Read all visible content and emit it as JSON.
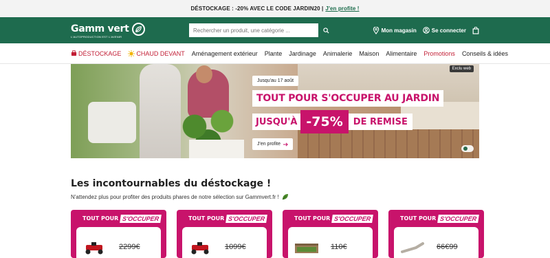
{
  "promo_bar": {
    "text": "DÉSTOCKAGE : -20% AVEC LE CODE JARDIN20 |",
    "link": "J'en profite !"
  },
  "header": {
    "logo_text": "Gamm vert",
    "logo_tagline": "L'AUTOPRODUCTION EST L'AVENIR",
    "search_placeholder": "Rechercher un produit, une catégorie ...",
    "store_label": "Mon magasin",
    "login_label": "Se connecter"
  },
  "nav": {
    "items": [
      {
        "label": "DÉSTOCKAGE",
        "icon": "tag-icon"
      },
      {
        "label": "CHAUD DEVANT",
        "icon": "sun-icon"
      },
      {
        "label": "Aménagement extérieur"
      },
      {
        "label": "Plante"
      },
      {
        "label": "Jardinage"
      },
      {
        "label": "Animalerie"
      },
      {
        "label": "Maison"
      },
      {
        "label": "Alimentaire"
      },
      {
        "label": "Promotions"
      },
      {
        "label": "Conseils & idées"
      }
    ]
  },
  "banner": {
    "exclu": "Exclu web",
    "date": "Jusqu'au 17 août",
    "title_line1": "TOUT POUR S'OCCUPER AU JARDIN",
    "title_jusqua": "JUSQU'À",
    "title_percent": "-75%",
    "title_remise": "DE REMISE",
    "cta": "J'en profite"
  },
  "section": {
    "title": "Les incontournables du déstockage !",
    "subtitle": "N'attendez plus pour profiter des produits phares de notre sélection sur Gammvert.fr !"
  },
  "cards": [
    {
      "badge1": "TOUT POUR",
      "badge2": "S'OCCUPER",
      "price": "2299€",
      "product": "lawn-tractor"
    },
    {
      "badge1": "TOUT POUR",
      "badge2": "S'OCCUPER",
      "price": "1099€",
      "product": "lawn-tractor"
    },
    {
      "badge1": "TOUT POUR",
      "badge2": "S'OCCUPER",
      "price": "110€",
      "product": "garden-box"
    },
    {
      "badge1": "TOUT POUR",
      "badge2": "S'OCCUPER",
      "price": "66€99",
      "product": "lounger"
    }
  ],
  "colors": {
    "brand_green": "#1e6b4e",
    "accent_pink": "#c8136b",
    "nav_red": "#c21e35"
  }
}
